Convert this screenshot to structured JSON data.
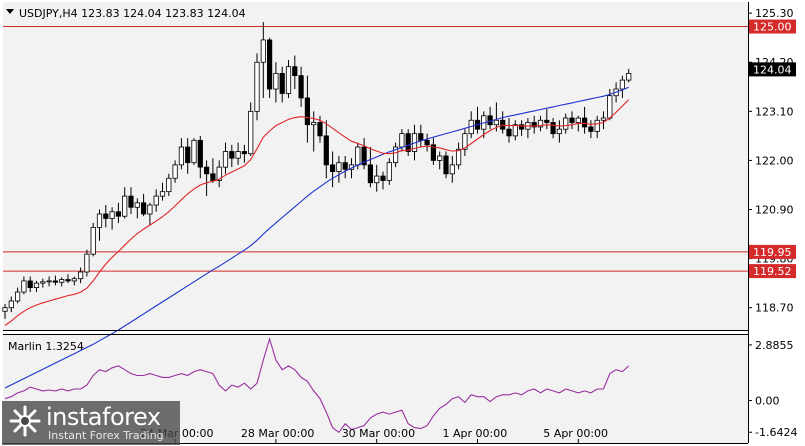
{
  "header": {
    "symbol_line": "USDJPY,H4  123.83 124.04 123.83 124.04"
  },
  "indicator": {
    "label": "Marlin 1.3254"
  },
  "watermark": {
    "name": "instaforex",
    "tagline": "Instant Forex Trading"
  },
  "colors": {
    "background": "#ffffff",
    "plot_background": "#f2f2f2",
    "axis": "#000000",
    "candle_up": "#ffffff",
    "candle_down": "#000000",
    "ma_fast": "#e0262a",
    "ma_slow": "#1d33d0",
    "level": "#d42a2a",
    "marlin": "#9a2fa0"
  },
  "chart_data": [
    {
      "type": "candlestick",
      "title": "USDJPY,H4",
      "ohlc_header": {
        "open": 123.83,
        "high": 124.04,
        "low": 123.83,
        "close": 124.04
      },
      "y_ticks": [
        125.3,
        124.2,
        123.1,
        122.0,
        120.9,
        119.8,
        118.7
      ],
      "y_tick_labels": [
        "125.30",
        "124.20",
        "123.10",
        "122.00",
        "120.90",
        "119.80",
        "118.70"
      ],
      "ylim": [
        118.2,
        125.55
      ],
      "x_tick_labels": [
        "24 Mar 00:00",
        "28 Mar 00:00",
        "30 Mar 00:00",
        "1 Apr 00:00",
        "5 Apr 00:00"
      ],
      "x_tick_candle_index": [
        27,
        43,
        59,
        75,
        91
      ],
      "levels": [
        {
          "value": 125.0,
          "label": "125.00"
        },
        {
          "value": 119.95,
          "label": "119.95"
        },
        {
          "value": 119.52,
          "label": "119.52"
        }
      ],
      "current_price": {
        "value": 124.04,
        "label": "124.04"
      },
      "candles": [
        [
          118.62,
          118.78,
          118.45,
          118.7
        ],
        [
          118.7,
          118.95,
          118.6,
          118.85
        ],
        [
          118.85,
          119.15,
          118.8,
          119.05
        ],
        [
          119.05,
          119.4,
          119.0,
          119.3
        ],
        [
          119.3,
          119.4,
          119.05,
          119.15
        ],
        [
          119.15,
          119.3,
          119.05,
          119.25
        ],
        [
          119.25,
          119.35,
          119.15,
          119.28
        ],
        [
          119.28,
          119.4,
          119.18,
          119.3
        ],
        [
          119.3,
          119.42,
          119.2,
          119.27
        ],
        [
          119.27,
          119.38,
          119.18,
          119.33
        ],
        [
          119.33,
          119.45,
          119.25,
          119.3
        ],
        [
          119.3,
          119.4,
          119.2,
          119.35
        ],
        [
          119.35,
          119.6,
          119.25,
          119.5
        ],
        [
          119.5,
          120.0,
          119.4,
          119.9
        ],
        [
          119.9,
          120.6,
          119.85,
          120.5
        ],
        [
          120.5,
          120.9,
          120.2,
          120.8
        ],
        [
          120.8,
          121.0,
          120.5,
          120.7
        ],
        [
          120.7,
          120.95,
          120.45,
          120.85
        ],
        [
          120.85,
          121.05,
          120.6,
          120.75
        ],
        [
          120.75,
          121.4,
          120.7,
          121.2
        ],
        [
          121.2,
          121.4,
          120.8,
          120.95
        ],
        [
          120.95,
          121.15,
          120.7,
          121.05
        ],
        [
          121.05,
          121.25,
          120.75,
          120.8
        ],
        [
          120.8,
          121.05,
          120.55,
          121.0
        ],
        [
          121.0,
          121.35,
          120.85,
          121.2
        ],
        [
          121.2,
          121.5,
          121.1,
          121.3
        ],
        [
          121.3,
          121.7,
          121.2,
          121.6
        ],
        [
          121.6,
          122.0,
          121.5,
          121.9
        ],
        [
          121.9,
          122.5,
          121.8,
          122.3
        ],
        [
          122.3,
          122.5,
          121.7,
          121.95
        ],
        [
          121.95,
          122.5,
          121.9,
          122.45
        ],
        [
          122.45,
          122.55,
          121.6,
          121.85
        ],
        [
          121.85,
          122.0,
          121.2,
          121.7
        ],
        [
          121.7,
          122.05,
          121.5,
          121.55
        ],
        [
          121.55,
          122.0,
          121.4,
          121.85
        ],
        [
          121.85,
          122.4,
          121.7,
          122.2
        ],
        [
          122.2,
          122.35,
          121.85,
          122.05
        ],
        [
          122.05,
          122.4,
          121.9,
          122.2
        ],
        [
          122.2,
          122.35,
          121.95,
          122.15
        ],
        [
          122.15,
          123.3,
          122.1,
          123.1
        ],
        [
          123.1,
          124.4,
          122.9,
          124.2
        ],
        [
          124.2,
          125.1,
          123.4,
          124.7
        ],
        [
          124.7,
          124.75,
          123.4,
          123.6
        ],
        [
          123.6,
          124.2,
          123.3,
          123.95
        ],
        [
          123.95,
          124.1,
          123.3,
          123.5
        ],
        [
          123.5,
          124.25,
          123.4,
          124.1
        ],
        [
          124.1,
          124.35,
          123.6,
          123.9
        ],
        [
          123.9,
          124.1,
          123.2,
          123.4
        ],
        [
          123.4,
          123.9,
          122.4,
          122.8
        ],
        [
          122.8,
          123.1,
          122.2,
          122.85
        ],
        [
          122.85,
          123.0,
          122.4,
          122.55
        ],
        [
          122.55,
          122.9,
          121.6,
          121.9
        ],
        [
          121.9,
          122.2,
          121.4,
          121.75
        ],
        [
          121.75,
          122.1,
          121.5,
          121.95
        ],
        [
          121.95,
          122.1,
          121.6,
          121.8
        ],
        [
          121.8,
          122.05,
          121.6,
          121.9
        ],
        [
          121.9,
          122.4,
          121.8,
          122.3
        ],
        [
          122.3,
          122.5,
          121.8,
          121.9
        ],
        [
          121.9,
          122.3,
          121.4,
          121.5
        ],
        [
          121.5,
          121.9,
          121.3,
          121.65
        ],
        [
          121.65,
          121.75,
          121.35,
          121.55
        ],
        [
          121.55,
          122.05,
          121.45,
          121.95
        ],
        [
          121.95,
          122.4,
          121.85,
          122.3
        ],
        [
          122.3,
          122.7,
          122.2,
          122.6
        ],
        [
          122.6,
          122.7,
          122.1,
          122.2
        ],
        [
          122.2,
          122.8,
          122.0,
          122.6
        ],
        [
          122.6,
          122.8,
          122.3,
          122.45
        ],
        [
          122.45,
          122.6,
          122.2,
          122.35
        ],
        [
          122.35,
          122.5,
          121.9,
          122.0
        ],
        [
          122.0,
          122.2,
          121.8,
          122.1
        ],
        [
          122.1,
          122.2,
          121.6,
          121.7
        ],
        [
          121.7,
          122.1,
          121.5,
          121.9
        ],
        [
          121.9,
          122.4,
          121.8,
          122.25
        ],
        [
          122.25,
          122.7,
          122.1,
          122.6
        ],
        [
          122.6,
          123.1,
          122.5,
          122.9
        ],
        [
          122.9,
          123.2,
          122.6,
          122.7
        ],
        [
          122.7,
          123.1,
          122.5,
          123.0
        ],
        [
          123.0,
          123.2,
          122.7,
          122.8
        ],
        [
          122.8,
          123.3,
          122.65,
          122.9
        ],
        [
          122.9,
          123.1,
          122.6,
          122.7
        ],
        [
          122.7,
          122.95,
          122.4,
          122.55
        ],
        [
          122.55,
          122.9,
          122.45,
          122.8
        ],
        [
          122.8,
          122.9,
          122.55,
          122.7
        ],
        [
          122.7,
          122.95,
          122.5,
          122.85
        ],
        [
          122.85,
          123.0,
          122.6,
          122.75
        ],
        [
          122.75,
          123.0,
          122.65,
          122.9
        ],
        [
          122.9,
          123.15,
          122.7,
          122.85
        ],
        [
          122.85,
          122.95,
          122.5,
          122.6
        ],
        [
          122.6,
          122.9,
          122.4,
          122.7
        ],
        [
          122.7,
          123.05,
          122.6,
          122.95
        ],
        [
          122.95,
          123.1,
          122.7,
          122.85
        ],
        [
          122.85,
          123.0,
          122.65,
          122.95
        ],
        [
          122.95,
          123.2,
          122.6,
          122.75
        ],
        [
          122.75,
          122.9,
          122.5,
          122.65
        ],
        [
          122.65,
          123.0,
          122.5,
          122.9
        ],
        [
          122.9,
          123.1,
          122.7,
          122.95
        ],
        [
          122.95,
          123.6,
          122.9,
          123.45
        ],
        [
          123.45,
          123.75,
          123.3,
          123.6
        ],
        [
          123.6,
          123.9,
          123.4,
          123.8
        ],
        [
          123.8,
          124.05,
          123.75,
          123.95
        ]
      ],
      "ma_fast": [
        118.3,
        118.4,
        118.52,
        118.62,
        118.7,
        118.76,
        118.81,
        118.85,
        118.89,
        118.93,
        118.97,
        119.0,
        119.05,
        119.14,
        119.3,
        119.5,
        119.68,
        119.83,
        119.96,
        120.1,
        120.24,
        120.36,
        120.46,
        120.55,
        120.64,
        120.74,
        120.85,
        120.98,
        121.12,
        121.25,
        121.36,
        121.45,
        121.5,
        121.53,
        121.58,
        121.67,
        121.74,
        121.81,
        121.88,
        122.02,
        122.26,
        122.52,
        122.66,
        122.78,
        122.85,
        122.92,
        122.96,
        122.98,
        122.96,
        122.94,
        122.9,
        122.82,
        122.72,
        122.62,
        122.52,
        122.43,
        122.38,
        122.33,
        122.26,
        122.21,
        122.16,
        122.15,
        122.17,
        122.22,
        122.23,
        122.27,
        122.3,
        122.32,
        122.3,
        122.28,
        122.24,
        122.21,
        122.22,
        122.28,
        122.38,
        122.48,
        122.58,
        122.67,
        122.74,
        122.79,
        122.78,
        122.78,
        122.77,
        122.77,
        122.77,
        122.78,
        122.8,
        122.79,
        122.77,
        122.78,
        122.8,
        122.83,
        122.83,
        122.81,
        122.82,
        122.85,
        122.95,
        123.08,
        123.22,
        123.36
      ],
      "ma_slow": [
        116.9,
        116.97,
        117.04,
        117.11,
        117.18,
        117.25,
        117.32,
        117.39,
        117.46,
        117.53,
        117.6,
        117.67,
        117.74,
        117.81,
        117.88,
        117.96,
        118.04,
        118.12,
        118.2,
        118.29,
        118.38,
        118.47,
        118.56,
        118.65,
        118.74,
        118.83,
        118.92,
        119.01,
        119.1,
        119.19,
        119.28,
        119.37,
        119.46,
        119.55,
        119.63,
        119.72,
        119.81,
        119.9,
        119.99,
        120.09,
        120.21,
        120.35,
        120.48,
        120.6,
        120.72,
        120.84,
        120.96,
        121.08,
        121.2,
        121.31,
        121.41,
        121.51,
        121.6,
        121.68,
        121.76,
        121.83,
        121.9,
        121.96,
        122.02,
        122.08,
        122.14,
        122.19,
        122.24,
        122.29,
        122.34,
        122.39,
        122.44,
        122.48,
        122.52,
        122.56,
        122.6,
        122.64,
        122.68,
        122.72,
        122.76,
        122.8,
        122.84,
        122.88,
        122.92,
        122.96,
        122.99,
        123.02,
        123.05,
        123.08,
        123.11,
        123.14,
        123.17,
        123.2,
        123.23,
        123.26,
        123.29,
        123.32,
        123.35,
        123.38,
        123.41,
        123.44,
        123.48,
        123.53,
        123.58,
        123.64
      ]
    },
    {
      "type": "line",
      "title": "Marlin 1.3254",
      "y_ticks": [
        2.8855,
        0.0,
        -1.6424
      ],
      "y_tick_labels": [
        "2.8855",
        "0.00",
        "-1.6424"
      ],
      "ylim": [
        -2.2,
        3.4
      ],
      "series": [
        {
          "name": "Marlin",
          "values": [
            0.1,
            0.2,
            0.4,
            0.5,
            0.7,
            0.6,
            0.5,
            0.55,
            0.5,
            0.6,
            0.5,
            0.6,
            0.6,
            0.8,
            1.3,
            1.6,
            1.5,
            1.7,
            1.8,
            1.6,
            1.4,
            1.3,
            1.3,
            1.4,
            1.3,
            1.2,
            1.2,
            1.3,
            1.4,
            1.3,
            1.5,
            1.6,
            1.5,
            1.4,
            0.8,
            0.5,
            0.8,
            0.7,
            0.9,
            0.6,
            0.9,
            2.1,
            3.2,
            2.1,
            1.6,
            1.8,
            1.6,
            1.2,
            1.0,
            0.5,
            0.1,
            -0.6,
            -1.4,
            -1.65,
            -1.2,
            -1.5,
            -1.4,
            -1.3,
            -0.9,
            -0.7,
            -0.6,
            -0.7,
            -0.6,
            -0.5,
            -1.2,
            -1.4,
            -1.45,
            -1.3,
            -0.8,
            -0.4,
            -0.2,
            0.1,
            0.2,
            -0.1,
            0.3,
            0.2,
            0.2,
            -0.05,
            0.2,
            0.3,
            0.3,
            0.4,
            0.3,
            0.5,
            0.6,
            0.4,
            0.6,
            0.5,
            0.4,
            0.6,
            0.5,
            0.4,
            0.5,
            0.4,
            0.6,
            0.6,
            1.4,
            1.6,
            1.5,
            1.8
          ]
        }
      ]
    }
  ]
}
